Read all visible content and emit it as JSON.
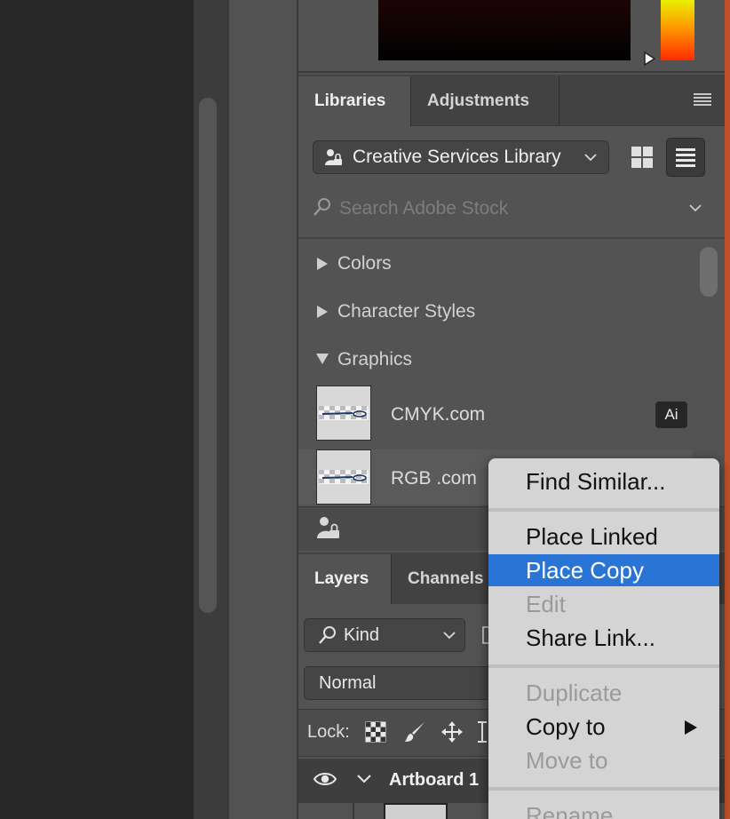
{
  "colors": {
    "panel_bg": "#535353",
    "panel_dark": "#424242",
    "menu_bg": "#d4d4d4",
    "menu_highlight": "#2a74d6",
    "accent_red": "#c0502a"
  },
  "libraries_panel": {
    "tabs": [
      {
        "label": "Libraries",
        "active": true
      },
      {
        "label": "Adjustments",
        "active": false
      }
    ],
    "menu_icon": "hamburger-menu-icon",
    "library_select": {
      "value": "Creative Services Library",
      "icon": "shared-library-icon"
    },
    "view_buttons": [
      {
        "name": "grid-view-icon",
        "active": false
      },
      {
        "name": "list-view-icon",
        "active": true
      }
    ],
    "search": {
      "placeholder": "Search Adobe Stock",
      "value": ""
    },
    "sections": [
      {
        "label": "Colors",
        "expanded": false
      },
      {
        "label": "Character Styles",
        "expanded": false
      },
      {
        "label": "Graphics",
        "expanded": true
      }
    ],
    "graphics": [
      {
        "label": "CMYK.com",
        "badge": "Ai"
      },
      {
        "label": "RGB .com",
        "badge": ""
      }
    ],
    "footer_icon": "library-permissions-icon"
  },
  "layers_panel": {
    "tabs": [
      {
        "label": "Layers",
        "active": true
      },
      {
        "label": "Channels",
        "active": false
      }
    ],
    "kind_filter": {
      "value": "Kind"
    },
    "blend_mode": {
      "value": "Normal"
    },
    "lock_label": "Lock:",
    "lock_icons": [
      "lock-transparent-pixels-icon",
      "lock-image-pixels-icon",
      "lock-position-icon",
      "lock-artboard-icon"
    ],
    "artboard": {
      "label": "Artboard 1",
      "visible": true
    }
  },
  "context_menu": {
    "items": [
      {
        "label": "Find Similar...",
        "enabled": true,
        "highlighted": false
      },
      {
        "label": "Place Linked",
        "enabled": true,
        "highlighted": false
      },
      {
        "label": "Place Copy",
        "enabled": true,
        "highlighted": true
      },
      {
        "label": "Edit",
        "enabled": false,
        "highlighted": false
      },
      {
        "label": "Share Link...",
        "enabled": true,
        "highlighted": false
      },
      {
        "label": "Duplicate",
        "enabled": false,
        "highlighted": false
      },
      {
        "label": "Copy to",
        "enabled": true,
        "highlighted": false,
        "submenu": true
      },
      {
        "label": "Move to",
        "enabled": false,
        "highlighted": false
      },
      {
        "label": "Rename",
        "enabled": false,
        "highlighted": false
      }
    ]
  }
}
